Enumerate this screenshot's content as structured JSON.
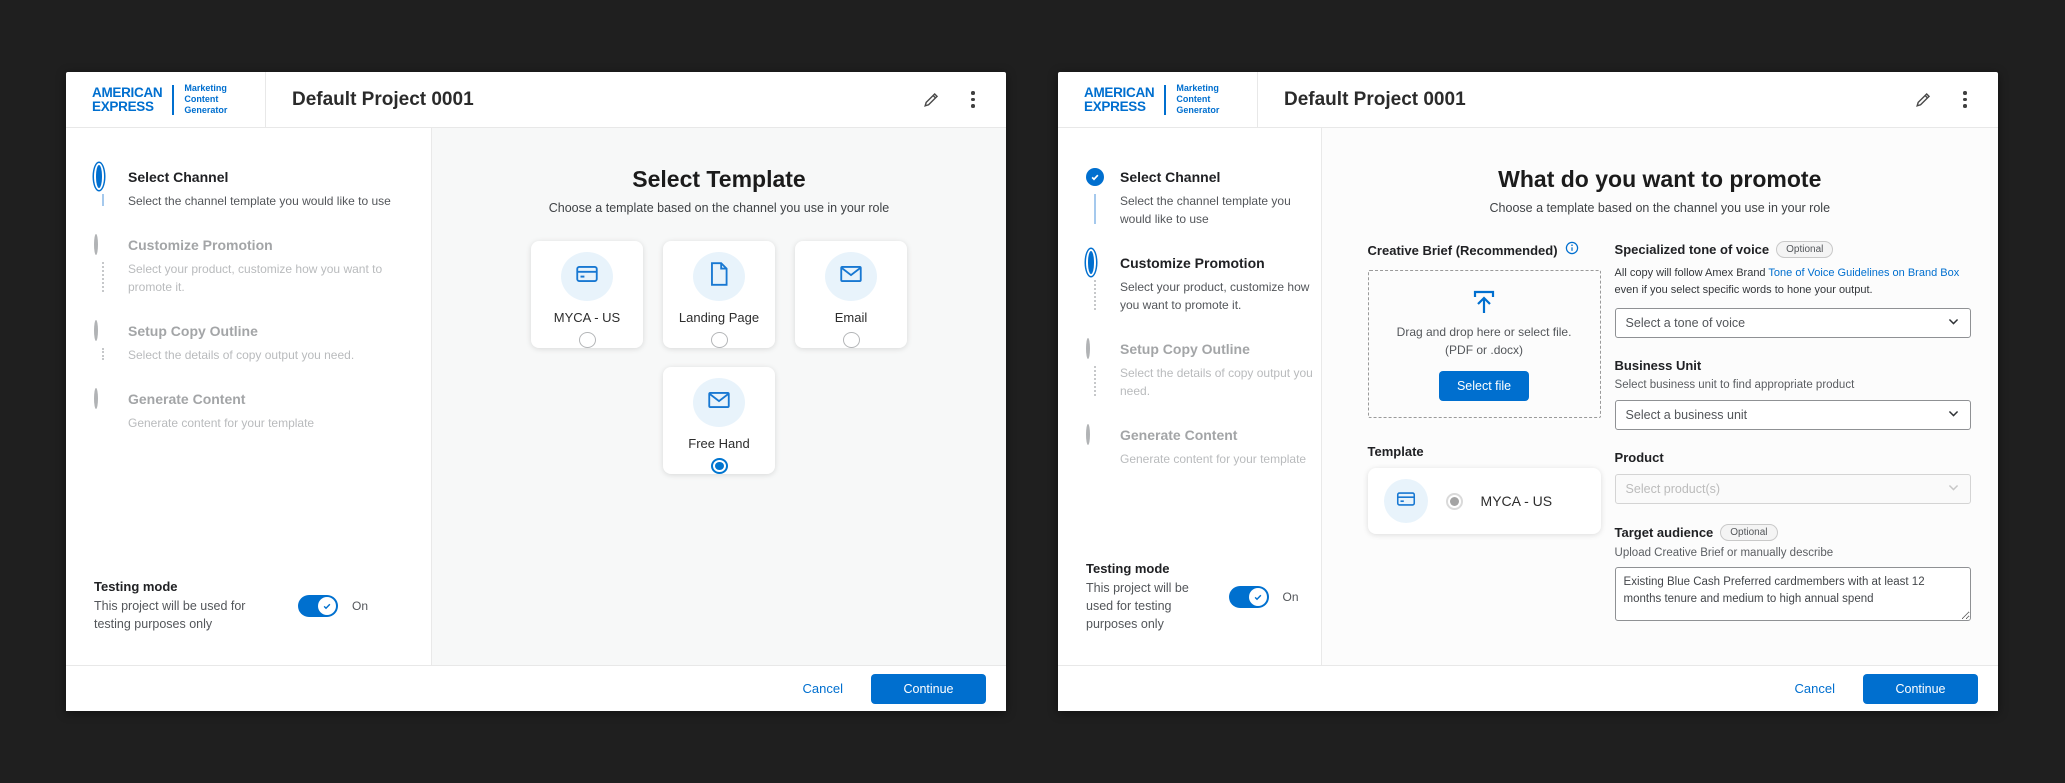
{
  "colors": {
    "brand_blue": "#006FCF",
    "toggle_on_blue": "#0070CF",
    "icon_circle_blue": "#E8F3FB",
    "page_background": "#1F1F1F",
    "inactive_gray": "#A3A5A7"
  },
  "logo": {
    "line1": "AMERICAN",
    "line2": "EXPRESS",
    "product_line1": "Marketing",
    "product_line2": "Content",
    "product_line3": "Generator"
  },
  "header": {
    "title": "Default Project 0001"
  },
  "steps": [
    {
      "title": "Select Channel",
      "desc": "Select the channel template you would like to use"
    },
    {
      "title": "Customize Promotion",
      "desc": "Select your product, customize how you want to promote it."
    },
    {
      "title": "Setup Copy Outline",
      "desc": "Select the details of copy output you need."
    },
    {
      "title": "Generate Content",
      "desc": "Generate content for your template"
    }
  ],
  "testing": {
    "title": "Testing mode",
    "desc": "This project will be used for testing purposes only",
    "state_label": "On"
  },
  "footer": {
    "cancel": "Cancel",
    "continue": "Continue"
  },
  "left_main": {
    "title": "Select Template",
    "subtitle": "Choose a template based on the channel you use in your role",
    "templates": [
      {
        "label": "MYCA - US",
        "icon": "credit-card-icon",
        "selected": false
      },
      {
        "label": "Landing Page",
        "icon": "page-icon",
        "selected": false
      },
      {
        "label": "Email",
        "icon": "envelope-icon",
        "selected": false
      },
      {
        "label": "Free Hand",
        "icon": "envelope-icon",
        "selected": true
      }
    ]
  },
  "right_main": {
    "title": "What do you want to promote",
    "subtitle": "Choose a template based on the channel you use in your role",
    "creative_brief": {
      "label": "Creative Brief (Recommended)",
      "info_icon": "info-icon",
      "drop_line1": "Drag and drop here or select file.",
      "drop_line2": "(PDF or .docx)",
      "button": "Select file"
    },
    "template_section": {
      "label": "Template",
      "card_label": "MYCA - US",
      "icon": "credit-card-icon"
    },
    "tone": {
      "label": "Specialized tone of voice",
      "badge": "Optional",
      "desc_before": "All copy will follow Amex Brand ",
      "desc_link": "Tone of Voice Guidelines on Brand Box",
      "desc_after": " even if you select specific words to hone your output.",
      "placeholder": "Select a tone of voice"
    },
    "business_unit": {
      "label": "Business Unit",
      "helper": "Select business unit to find appropriate product",
      "placeholder": "Select a business unit"
    },
    "product": {
      "label": "Product",
      "placeholder": "Select product(s)"
    },
    "audience": {
      "label": "Target audience",
      "badge": "Optional",
      "helper": "Upload Creative Brief or manually describe",
      "value": "Existing Blue Cash Preferred cardmembers with at least 12 months tenure and medium to high annual spend"
    }
  }
}
